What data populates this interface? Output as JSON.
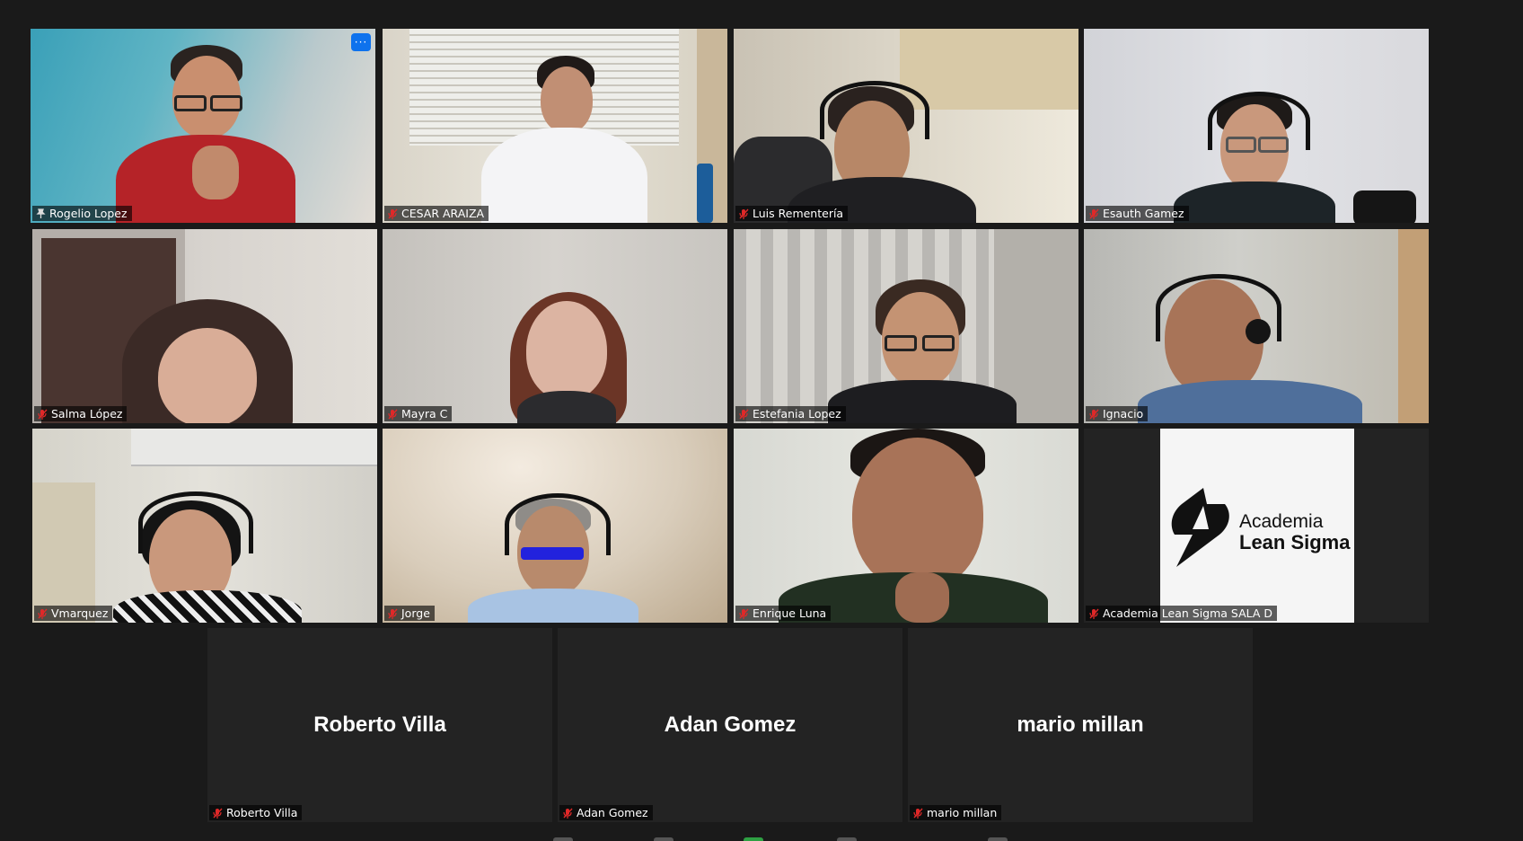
{
  "participants": {
    "rogelio": {
      "name": "Rogelio Lopez"
    },
    "cesar": {
      "name": "CESAR ARAIZA"
    },
    "luis": {
      "name": "Luis Rementería"
    },
    "esauth": {
      "name": "Esauth Gamez"
    },
    "salma": {
      "name": "Salma López"
    },
    "mayra": {
      "name": "Mayra C"
    },
    "estefania": {
      "name": "Estefania Lopez"
    },
    "ignacio": {
      "name": "Ignacio"
    },
    "vmarquez": {
      "name": "Vmarquez"
    },
    "jorge": {
      "name": "Jorge"
    },
    "enrique": {
      "name": "Enrique Luna"
    },
    "academia": {
      "name": "Academia Lean Sigma SALA D",
      "logo_line1": "Academia",
      "logo_line2": "Lean Sigma"
    },
    "roberto": {
      "name": "Roberto Villa",
      "display": "Roberto Villa"
    },
    "adan": {
      "name": "Adan Gomez",
      "display": "Adan Gomez"
    },
    "mario": {
      "name": "mario millan",
      "display": "mario millan"
    }
  },
  "more_button_label": "···",
  "colors": {
    "background": "#1a1a1a",
    "tile": "#232323",
    "active_speaker_border": "#d5e26b",
    "mute_icon": "#e02828",
    "more_button": "#0e72ed"
  }
}
